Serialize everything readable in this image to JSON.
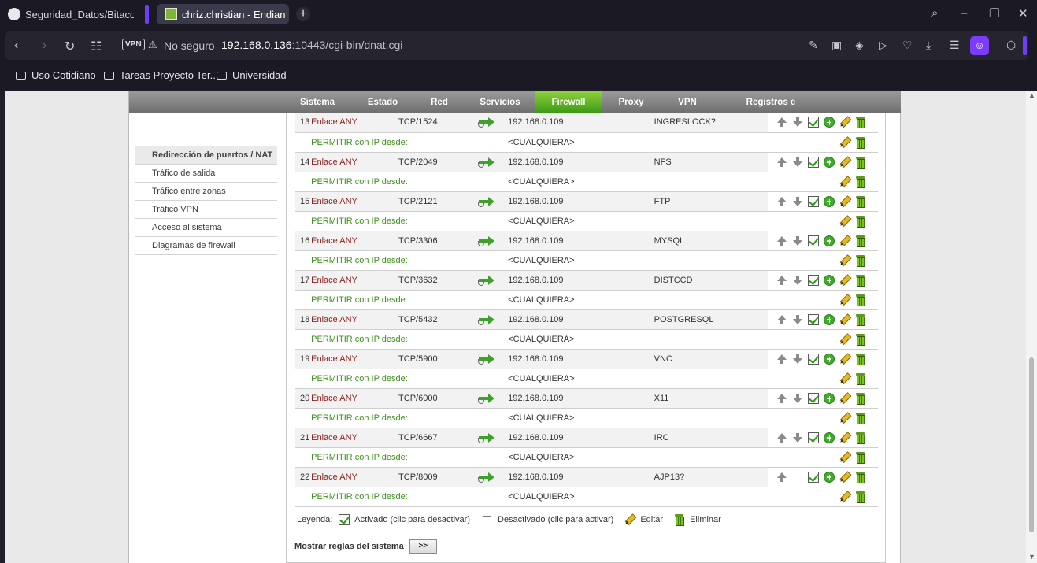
{
  "browser": {
    "tabs": [
      {
        "title": "Seguridad_Datos/Bitacora",
        "icon": "github-icon"
      },
      {
        "title": "chriz.christian - Endian Fire",
        "icon": "endian-favicon"
      }
    ],
    "address": {
      "vpn_label": "VPN",
      "security": "No seguro",
      "url_host": "192.168.0.136",
      "url_rest": ":10443/cgi-bin/dnat.cgi"
    },
    "bookmarks": [
      "Uso Cotidiano",
      "Tareas Proyecto Ter...",
      "Universidad"
    ]
  },
  "menu": {
    "items": [
      "Sistema",
      "Estado",
      "Red",
      "Servicios",
      "Firewall",
      "Proxy",
      "VPN",
      "Registros e informes"
    ],
    "active": "Firewall",
    "active_color": "#5cb82a"
  },
  "sidebar": {
    "items": [
      {
        "label": "Redirección de puertos / NAT",
        "active": true
      },
      {
        "label": "Tráfico de salida"
      },
      {
        "label": "Tráfico entre zonas"
      },
      {
        "label": "Tráfico VPN"
      },
      {
        "label": "Acceso al sistema"
      },
      {
        "label": "Diagramas de firewall"
      }
    ]
  },
  "rules_common": {
    "interface": "Enlace ANY",
    "permit_label": "PERMITIR con IP desde:",
    "source_any": "<CUALQUIERA>",
    "dest_ip": "192.168.0.109"
  },
  "rules": [
    {
      "num": "13",
      "iface": "Enlace ANY",
      "proto": "TCP/1524",
      "dest": "192.168.0.109",
      "service": "INGRESLOCK?",
      "permit": "PERMITIR con IP desde:",
      "source": "<CUALQUIERA>"
    },
    {
      "num": "14",
      "iface": "Enlace ANY",
      "proto": "TCP/2049",
      "dest": "192.168.0.109",
      "service": "NFS",
      "permit": "PERMITIR con IP desde:",
      "source": "<CUALQUIERA>"
    },
    {
      "num": "15",
      "iface": "Enlace ANY",
      "proto": "TCP/2121",
      "dest": "192.168.0.109",
      "service": "FTP",
      "permit": "PERMITIR con IP desde:",
      "source": "<CUALQUIERA>"
    },
    {
      "num": "16",
      "iface": "Enlace ANY",
      "proto": "TCP/3306",
      "dest": "192.168.0.109",
      "service": "MYSQL",
      "permit": "PERMITIR con IP desde:",
      "source": "<CUALQUIERA>"
    },
    {
      "num": "17",
      "iface": "Enlace ANY",
      "proto": "TCP/3632",
      "dest": "192.168.0.109",
      "service": "DISTCCD",
      "permit": "PERMITIR con IP desde:",
      "source": "<CUALQUIERA>"
    },
    {
      "num": "18",
      "iface": "Enlace ANY",
      "proto": "TCP/5432",
      "dest": "192.168.0.109",
      "service": "POSTGRESQL",
      "permit": "PERMITIR con IP desde:",
      "source": "<CUALQUIERA>"
    },
    {
      "num": "19",
      "iface": "Enlace ANY",
      "proto": "TCP/5900",
      "dest": "192.168.0.109",
      "service": "VNC",
      "permit": "PERMITIR con IP desde:",
      "source": "<CUALQUIERA>"
    },
    {
      "num": "20",
      "iface": "Enlace ANY",
      "proto": "TCP/6000",
      "dest": "192.168.0.109",
      "service": "X11",
      "permit": "PERMITIR con IP desde:",
      "source": "<CUALQUIERA>"
    },
    {
      "num": "21",
      "iface": "Enlace ANY",
      "proto": "TCP/6667",
      "dest": "192.168.0.109",
      "service": "IRC",
      "permit": "PERMITIR con IP desde:",
      "source": "<CUALQUIERA>"
    },
    {
      "num": "22",
      "iface": "Enlace ANY",
      "proto": "TCP/8009",
      "dest": "192.168.0.109",
      "service": "AJP13?",
      "permit": "PERMITIR con IP desde:",
      "source": "<CUALQUIERA>",
      "last": true
    }
  ],
  "legend": {
    "label": "Leyenda:",
    "enabled": "Activado (clic para desactivar)",
    "disabled": "Desactivado (clic para activar)",
    "edit": "Editar",
    "delete": "Eliminar"
  },
  "system_rules": {
    "label": "Mostrar reglas del sistema",
    "button": ">>"
  }
}
